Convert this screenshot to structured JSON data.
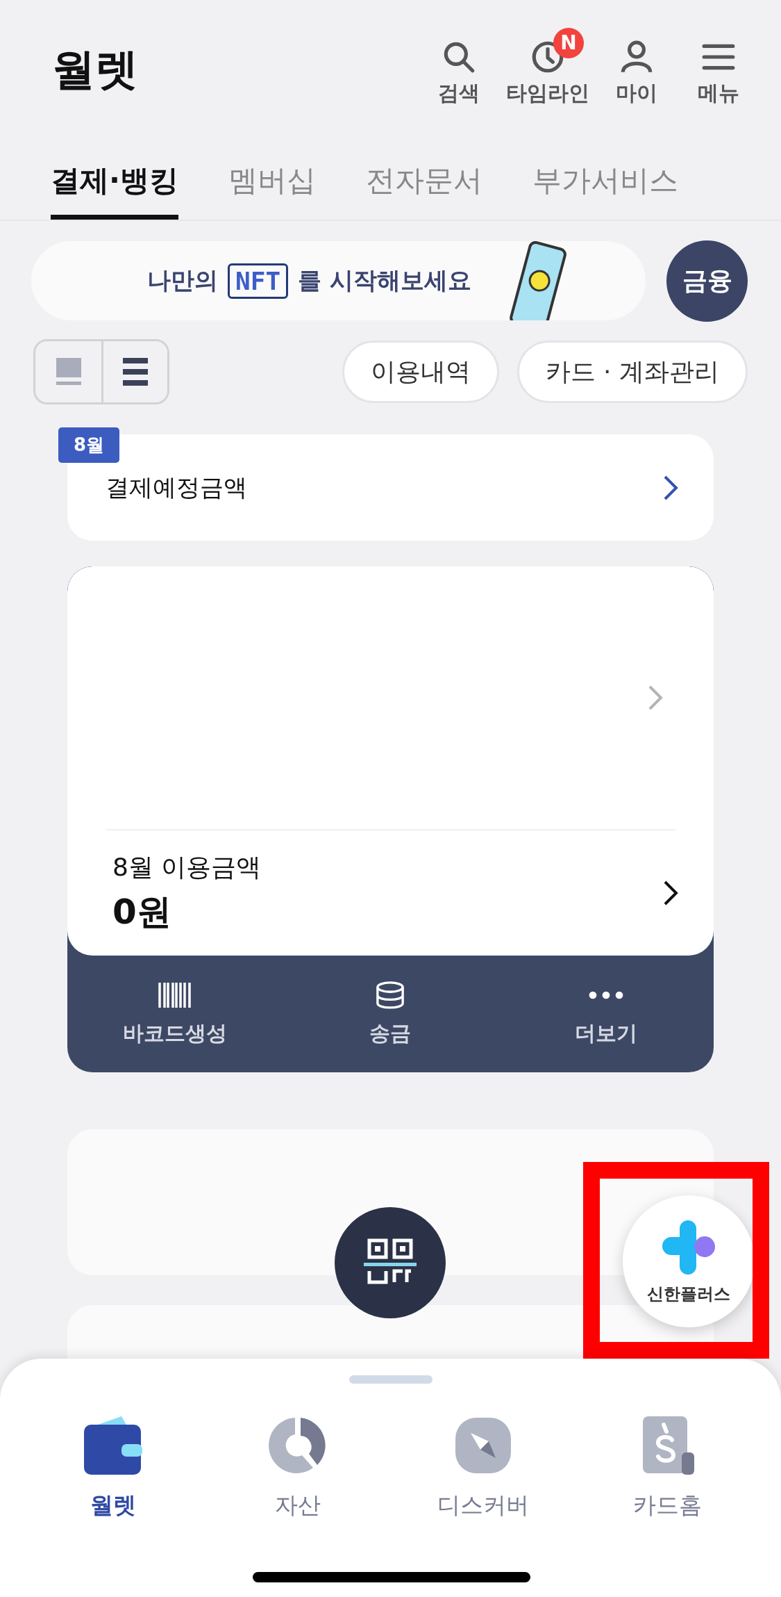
{
  "header": {
    "title": "월렛",
    "actions": [
      {
        "kind": "search",
        "label": "검색"
      },
      {
        "kind": "timeline",
        "label": "타임라인",
        "badge": "N"
      },
      {
        "kind": "my",
        "label": "마이"
      },
      {
        "kind": "menu",
        "label": "메뉴"
      }
    ]
  },
  "tabs": [
    {
      "label": "결제·뱅킹",
      "selected": true
    },
    {
      "label": "멤버십",
      "selected": false
    },
    {
      "label": "전자문서",
      "selected": false
    },
    {
      "label": "부가서비스",
      "selected": false
    }
  ],
  "banner": {
    "text_before": "나만의",
    "tag": "NFT",
    "text_after": "를 시작해보세요"
  },
  "finance_button": "금융",
  "view_toggle": [
    {
      "kind": "card",
      "selected": false
    },
    {
      "kind": "list",
      "selected": true
    }
  ],
  "chips": [
    "이용내역",
    "카드 · 계좌관리"
  ],
  "payment_due": {
    "badge": "8월",
    "label": "결제예정금액"
  },
  "usage": {
    "label": "8월 이용금액",
    "amount": "0원",
    "actions": [
      {
        "kind": "barcode",
        "label": "바코드생성"
      },
      {
        "kind": "transfer",
        "label": "송금"
      },
      {
        "kind": "more",
        "label": "더보기"
      }
    ]
  },
  "floating_button": {
    "label": "신한플러스"
  },
  "bottom_nav": [
    {
      "kind": "wallet",
      "label": "월렛",
      "selected": true
    },
    {
      "kind": "assets",
      "label": "자산",
      "selected": false
    },
    {
      "kind": "discover",
      "label": "디스커버",
      "selected": false
    },
    {
      "kind": "cardhome",
      "label": "카드홈",
      "selected": false
    }
  ]
}
